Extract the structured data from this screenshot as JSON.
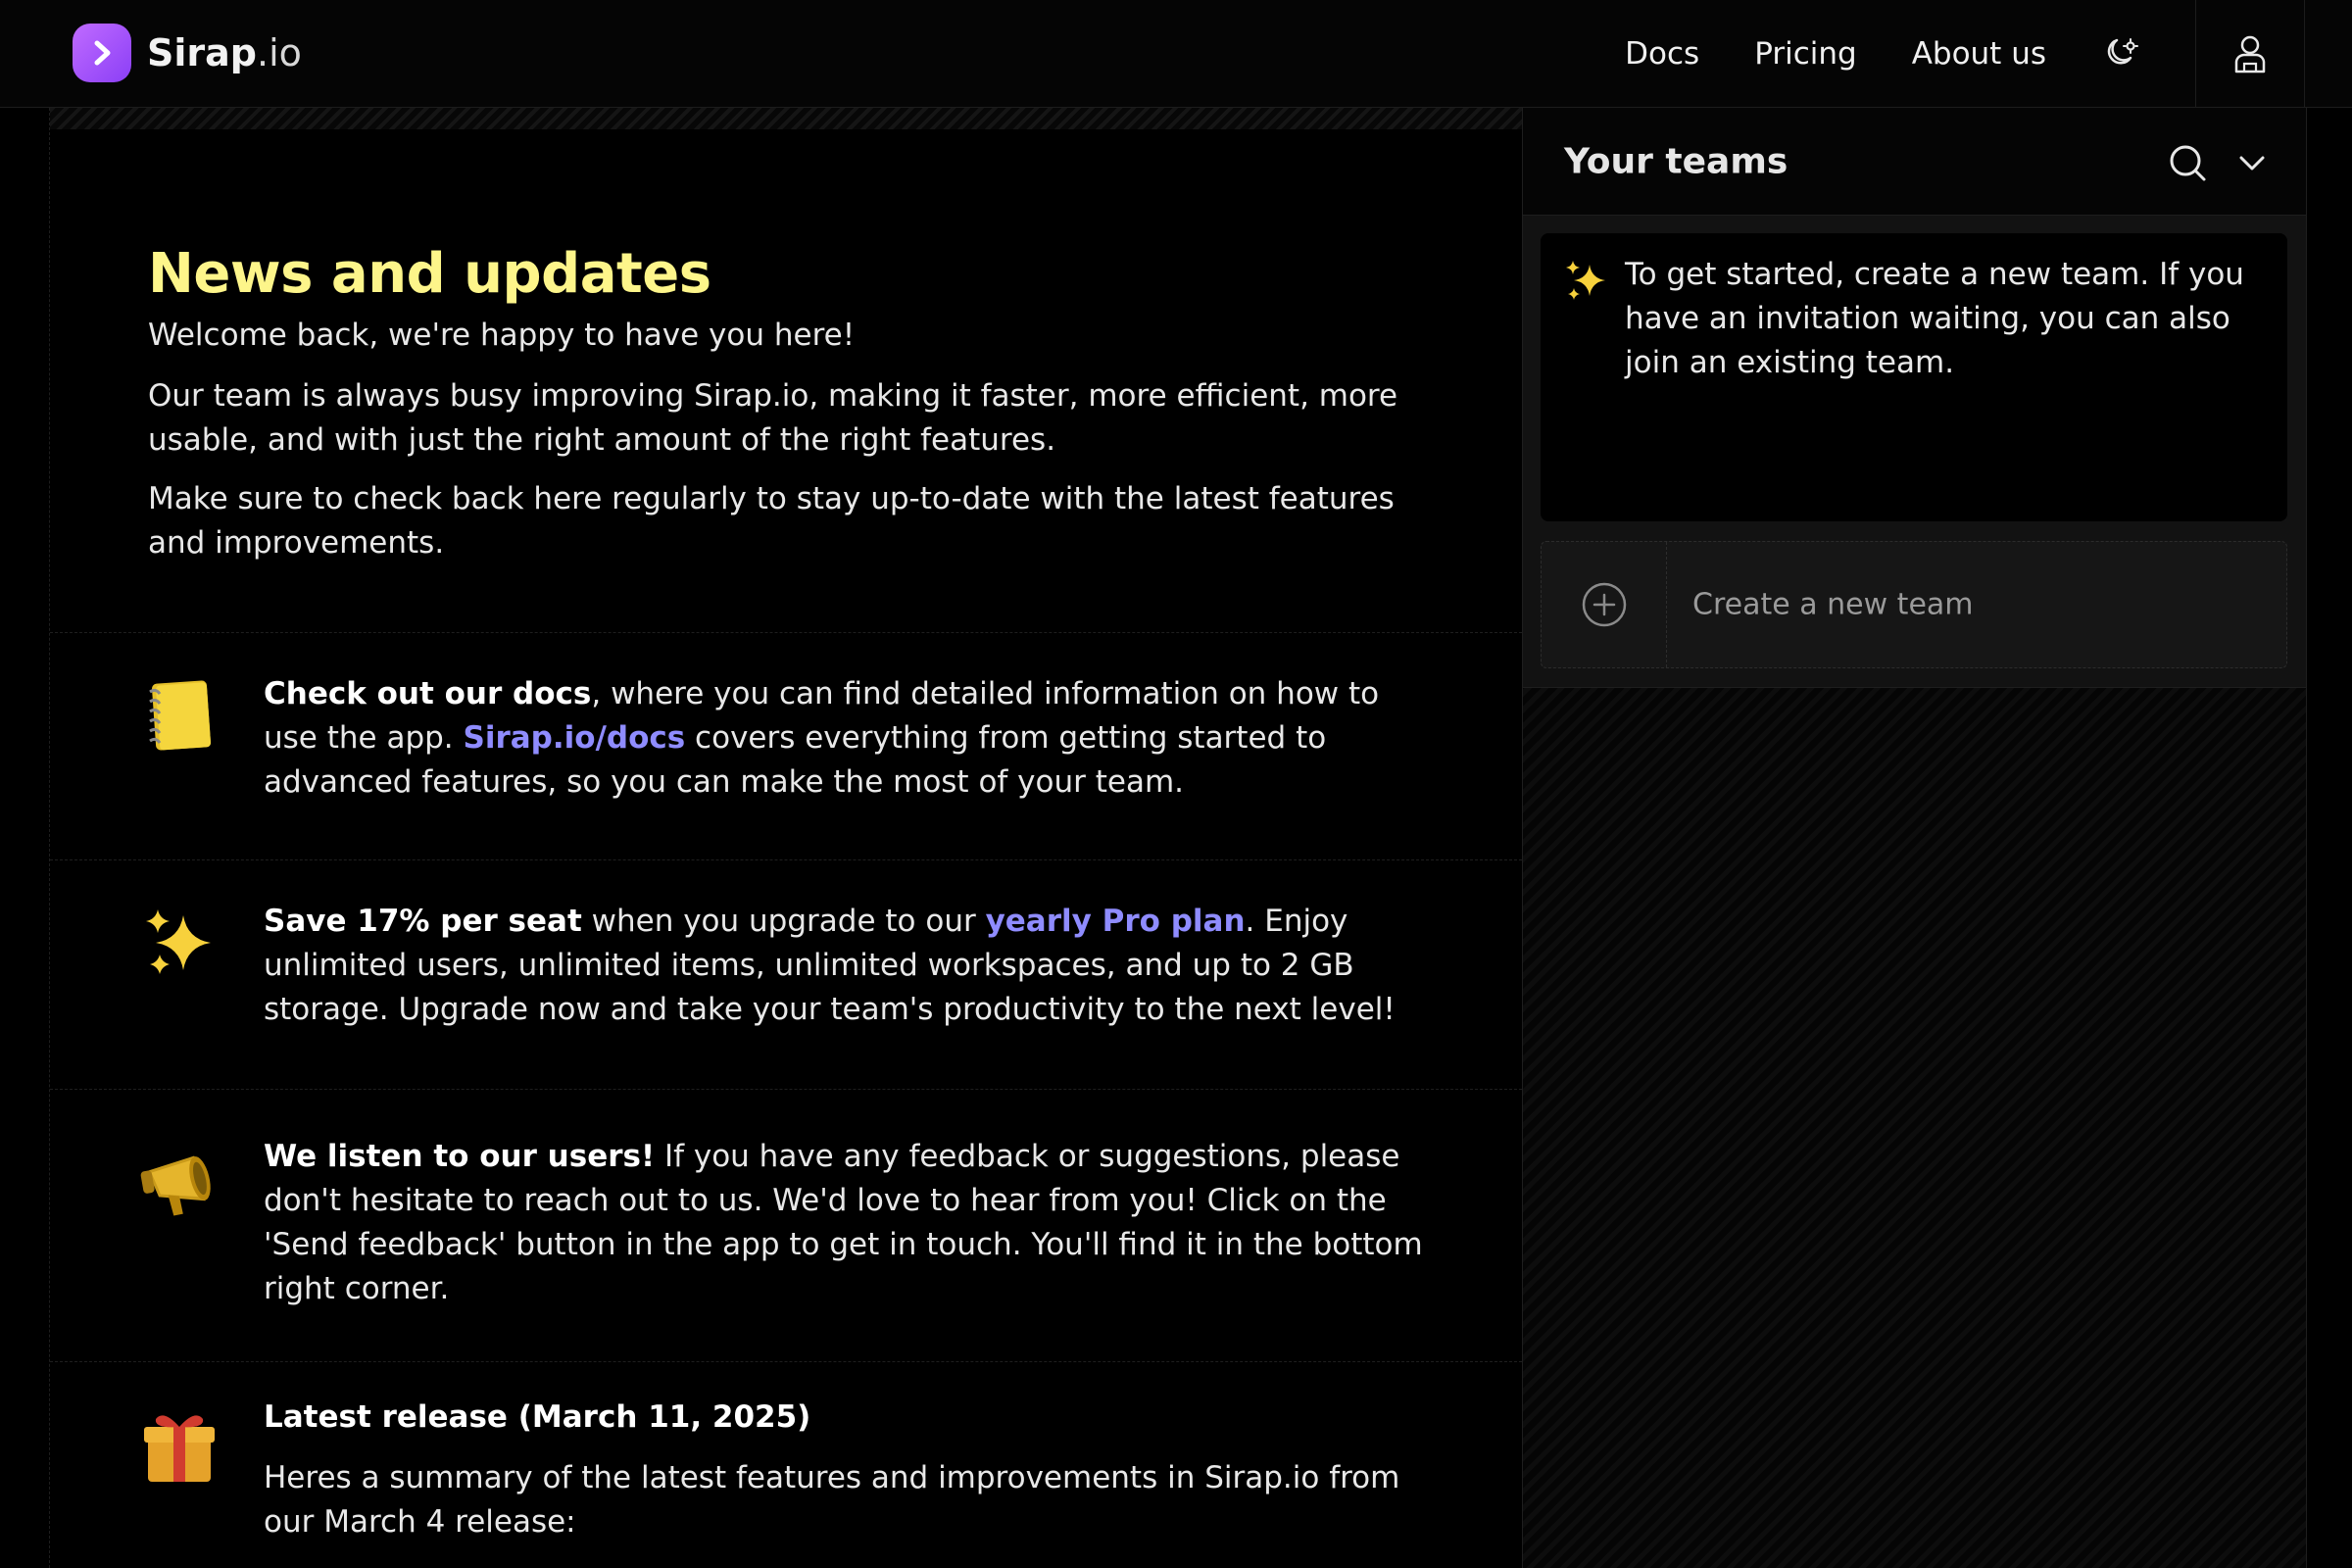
{
  "header": {
    "brand_bold": "Sirap",
    "brand_rest": ".io",
    "nav": [
      {
        "label": "Docs"
      },
      {
        "label": "Pricing"
      },
      {
        "label": "About us"
      }
    ],
    "icons": {
      "logo": "chevron-right-icon",
      "theme": "moon-sun-icon",
      "user": "user-icon"
    }
  },
  "hero": {
    "title": "News and updates",
    "p1": "Welcome back, we're happy to have you here!",
    "p2": "Our team is always busy improving Sirap.io, making it faster, more efficient, more usable, and with just the right amount of the right features.",
    "p3": "Make sure to check back here regularly to stay up-to-date with the latest features and improvements."
  },
  "news": [
    {
      "icon": "notebook-icon",
      "bold": "Check out our docs",
      "t1": ", where you can find detailed information on how to use the app. ",
      "link": "Sirap.io/docs",
      "t2": " covers everything from getting started to advanced features, so you can make the most of your team."
    },
    {
      "icon": "sparkles-icon",
      "bold": "Save 17% per seat",
      "t1": " when you upgrade to our ",
      "link": "yearly Pro plan",
      "t2": ". Enjoy unlimited users, unlimited items, unlimited workspaces, and up to 2 GB storage. Upgrade now and take your team's productivity to the next level!"
    },
    {
      "icon": "megaphone-icon",
      "bold": "We listen to our users!",
      "t1": " If you have any feedback or suggestions, please don't hesitate to reach out to us. We'd love to hear from you! Click on the 'Send feedback' button in the app to get in touch. You'll find it in the bottom right corner."
    },
    {
      "icon": "gift-icon",
      "bold": "Latest release (March 11, 2025)",
      "t1": "Heres a summary of the latest features and improvements in Sirap.io from our March 4 release:"
    }
  ],
  "panel": {
    "title": "Your teams",
    "info": "To get started, create a new team. If you have an invitation waiting, you can also join an existing team.",
    "create_label": "Create a new team",
    "icons": {
      "search": "search-icon",
      "chevron": "chevron-down-icon",
      "add": "plus-circle-icon",
      "info": "sparkles-icon"
    }
  },
  "colors": {
    "accent_yellow": "#fdf58a",
    "link": "#8f8cff",
    "brand_purple": "#a657fb",
    "background": "#000000"
  }
}
